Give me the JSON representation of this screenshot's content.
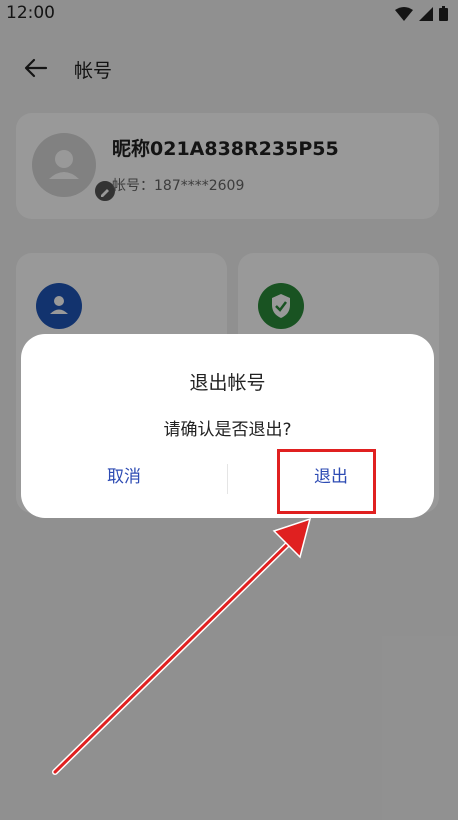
{
  "status": {
    "time": "12:00"
  },
  "header": {
    "title": "帐号"
  },
  "profile": {
    "nickname": "昵称021A838R235P55",
    "account_label": "帐号：187****2609"
  },
  "dialog": {
    "title": "退出帐号",
    "message": "请确认是否退出?",
    "cancel_label": "取消",
    "confirm_label": "退出"
  },
  "colors": {
    "accent_blue": "#2d4bb3",
    "tile_blue": "#1e56b8",
    "tile_green": "#2a8a3a",
    "highlight_red": "#e02020"
  }
}
